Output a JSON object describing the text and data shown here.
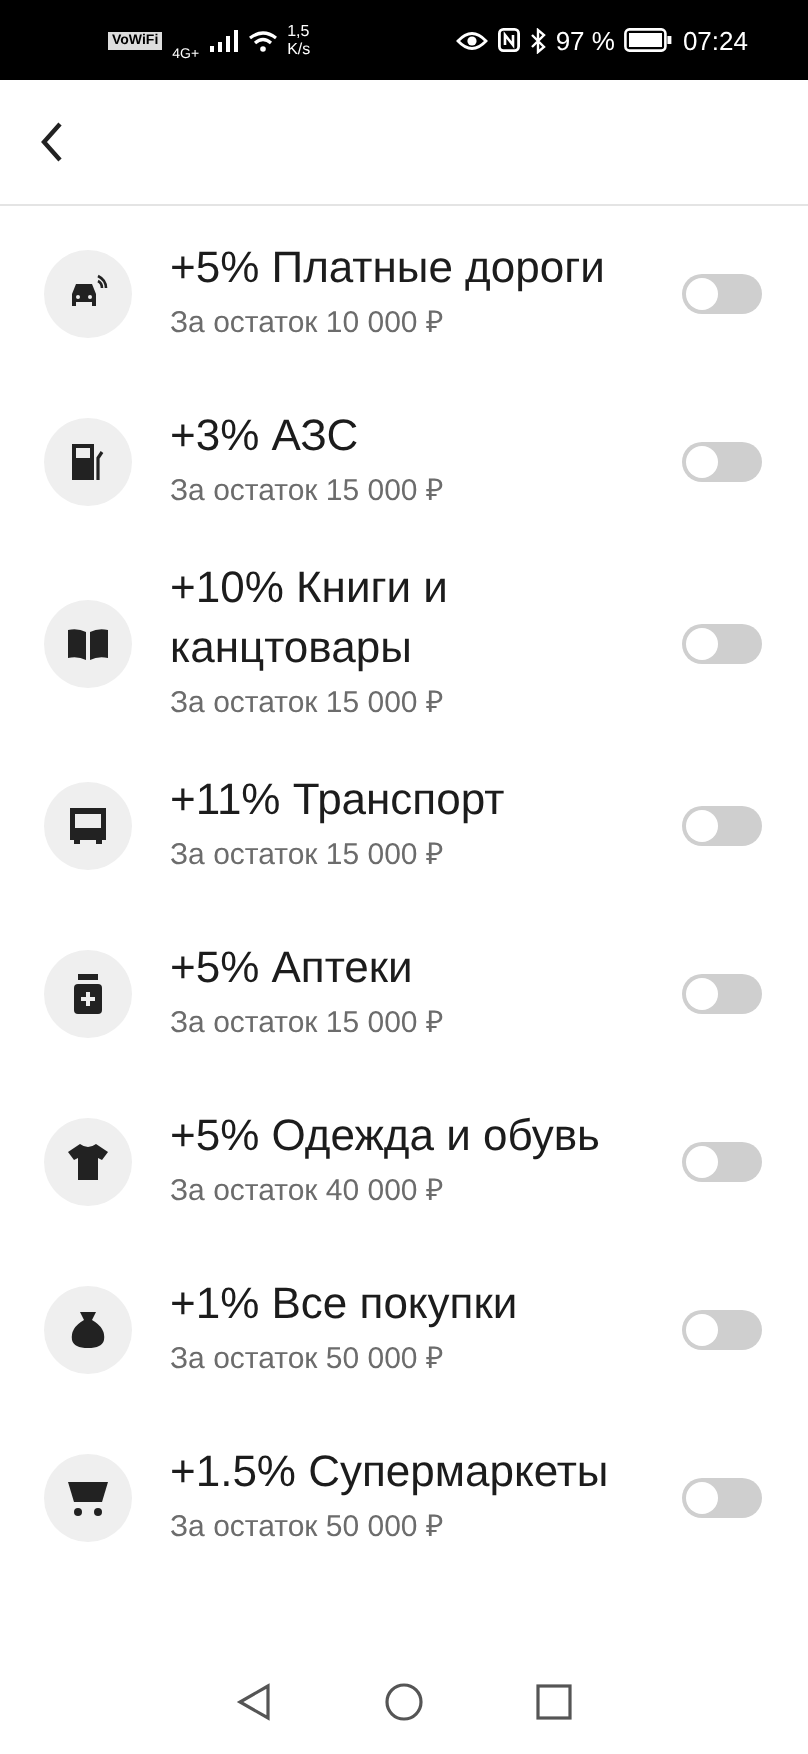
{
  "status_bar": {
    "vowifi": "VoWiFi",
    "network": "4G+",
    "speed_value": "1,5",
    "speed_unit": "K/s",
    "battery": "97 %",
    "time": "07:24"
  },
  "categories": [
    {
      "kind": "car",
      "title": "+5% Платные дороги",
      "subtitle": "За остаток 10 000 ₽",
      "on": false
    },
    {
      "kind": "fuel",
      "title": "+3% АЗС",
      "subtitle": "За остаток 15 000 ₽",
      "on": false
    },
    {
      "kind": "book",
      "title": "+10% Книги и канцтовары",
      "subtitle": "За остаток 15 000 ₽",
      "on": false
    },
    {
      "kind": "bus",
      "title": "+11% Транспорт",
      "subtitle": "За остаток 15 000 ₽",
      "on": false
    },
    {
      "kind": "pharmacy",
      "title": "+5% Аптеки",
      "subtitle": "За остаток 15 000 ₽",
      "on": false
    },
    {
      "kind": "clothes",
      "title": "+5% Одежда и обувь",
      "subtitle": "За остаток 40 000 ₽",
      "on": false
    },
    {
      "kind": "bag",
      "title": "+1% Все покупки",
      "subtitle": "За остаток 50 000 ₽",
      "on": false
    },
    {
      "kind": "cart",
      "title": "+1.5% Супермаркеты",
      "subtitle": "За остаток 50 000 ₽",
      "on": false
    }
  ]
}
